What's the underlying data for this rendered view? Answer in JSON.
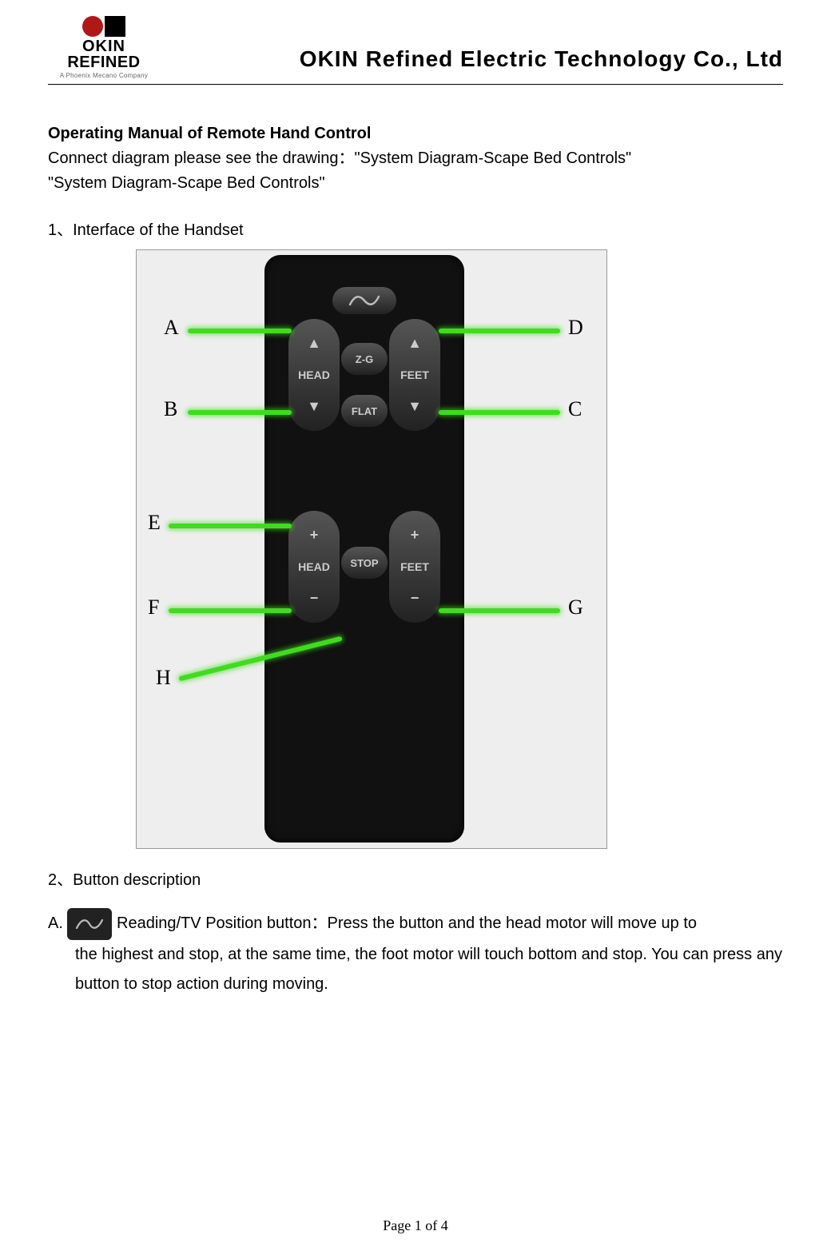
{
  "header": {
    "logo_line1": "OKIN",
    "logo_line2": "REFINED",
    "logo_tagline": "A Phoenix Mecano Company",
    "company_title": "OKIN Refined Electric Technology Co., Ltd"
  },
  "doc": {
    "title": "Operating Manual of Remote Hand Control",
    "connect_line": "Connect diagram please see the drawing：\"System Diagram-Scape Bed Controls\"",
    "connect_line2": "\"System Diagram-Scape Bed Controls\"",
    "section1_heading": "1、Interface of the Handset",
    "section2_heading": "2、Button description",
    "itemA_prefix": "A.",
    "itemA_text_part1": "Reading/TV Position button：Press the button and the head motor will move up to",
    "itemA_text_part2": "the highest and stop, at the same time, the foot motor will touch bottom and stop. You can press any button to stop action during moving."
  },
  "remote": {
    "buttons": {
      "head_upper": "HEAD",
      "feet_upper": "FEET",
      "zg": "Z-G",
      "flat": "FLAT",
      "head_lower": "HEAD",
      "feet_lower": "FEET",
      "stop": "STOP"
    },
    "callouts": {
      "A": "A",
      "B": "B",
      "C": "C",
      "D": "D",
      "E": "E",
      "F": "F",
      "G": "G",
      "H": "H"
    }
  },
  "footer": {
    "page_text": "Page 1 of 4"
  }
}
